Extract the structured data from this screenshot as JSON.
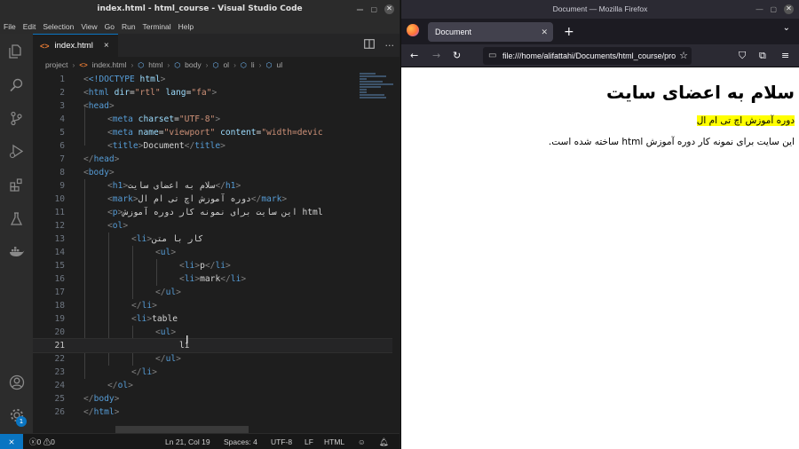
{
  "vscode": {
    "title": "index.html - html_course - Visual Studio Code",
    "menu": [
      "File",
      "Edit",
      "Selection",
      "View",
      "Go",
      "Run",
      "Terminal",
      "Help"
    ],
    "tab": {
      "label": "index.html",
      "close": "×"
    },
    "breadcrumb": {
      "folder": "project",
      "file": "index.html",
      "symbols": [
        "html",
        "body",
        "ol",
        "li",
        "ul"
      ]
    },
    "activity_icons": [
      "explorer-icon",
      "search-icon",
      "source-control-icon",
      "run-debug-icon",
      "extensions-icon",
      "testing-icon",
      "docker-icon",
      "account-icon",
      "settings-gear-icon"
    ],
    "settings_badge": "1",
    "current_line": 21,
    "code_lines": [
      {
        "n": "1"
      },
      {
        "n": "2"
      },
      {
        "n": "3"
      },
      {
        "n": "4"
      },
      {
        "n": "5"
      },
      {
        "n": "6"
      },
      {
        "n": "7"
      },
      {
        "n": "8"
      },
      {
        "n": "9"
      },
      {
        "n": "10"
      },
      {
        "n": "11"
      },
      {
        "n": "12"
      },
      {
        "n": "13"
      },
      {
        "n": "14"
      },
      {
        "n": "15"
      },
      {
        "n": "16"
      },
      {
        "n": "17"
      },
      {
        "n": "18"
      },
      {
        "n": "19"
      },
      {
        "n": "20"
      },
      {
        "n": "21"
      },
      {
        "n": "22"
      },
      {
        "n": "23"
      },
      {
        "n": "24"
      },
      {
        "n": "25"
      },
      {
        "n": "26"
      }
    ],
    "code": {
      "l1_doctype": "<!DOCTYPE",
      "l1_html": " html",
      "l1_close": ">",
      "l2_open": "<html",
      "l2_attr_dir": " dir",
      "l2_eq": "=",
      "l2_dir_val": "\"rtl\"",
      "l2_attr_lang": " lang",
      "l2_lang_val": "\"fa\"",
      "head": "head",
      "meta": "meta",
      "charset": "charset",
      "charset_val": "\"UTF-8\"",
      "name": "name",
      "viewport_val": "\"viewport\"",
      "content": "content",
      "content_val": "\"width=devic",
      "title": "title",
      "title_text": "Document",
      "body": "body",
      "h1": "h1",
      "h1_text": "سلام به اعضای سایت",
      "mark": "mark",
      "mark_text": "دوره آموزش اچ تی ام ال",
      "p": "p",
      "p_text": "این سایت برای نمونه کار دوره آموزش html",
      "ol": "ol",
      "li": "li",
      "li_text_1": "کار با متن",
      "ul": "ul",
      "li_p": "p",
      "li_mark": "mark",
      "li_table": "table",
      "typed": "li"
    },
    "status": {
      "errors": "0",
      "warnings": "0",
      "position": "Ln 21, Col 19",
      "spaces": "Spaces: 4",
      "encoding": "UTF-8",
      "eol": "LF",
      "language": "HTML"
    }
  },
  "firefox": {
    "title": "Document — Mozilla Firefox",
    "tab_label": "Document",
    "url": "file:///home/alifattahi/Documents/html_course/pro",
    "page": {
      "h1": "سلام به اعضای سایت",
      "mark": "دوره آموزش اچ تی ام ال",
      "p": "این سایت برای نمونه کار دوره آموزش html ساخته شده است."
    }
  },
  "colors": {
    "accent": "#0a75c2",
    "tag": "#569cd6",
    "attribute": "#9cdcfe",
    "string": "#ce9178",
    "mark_highlight": "#ffff00"
  }
}
